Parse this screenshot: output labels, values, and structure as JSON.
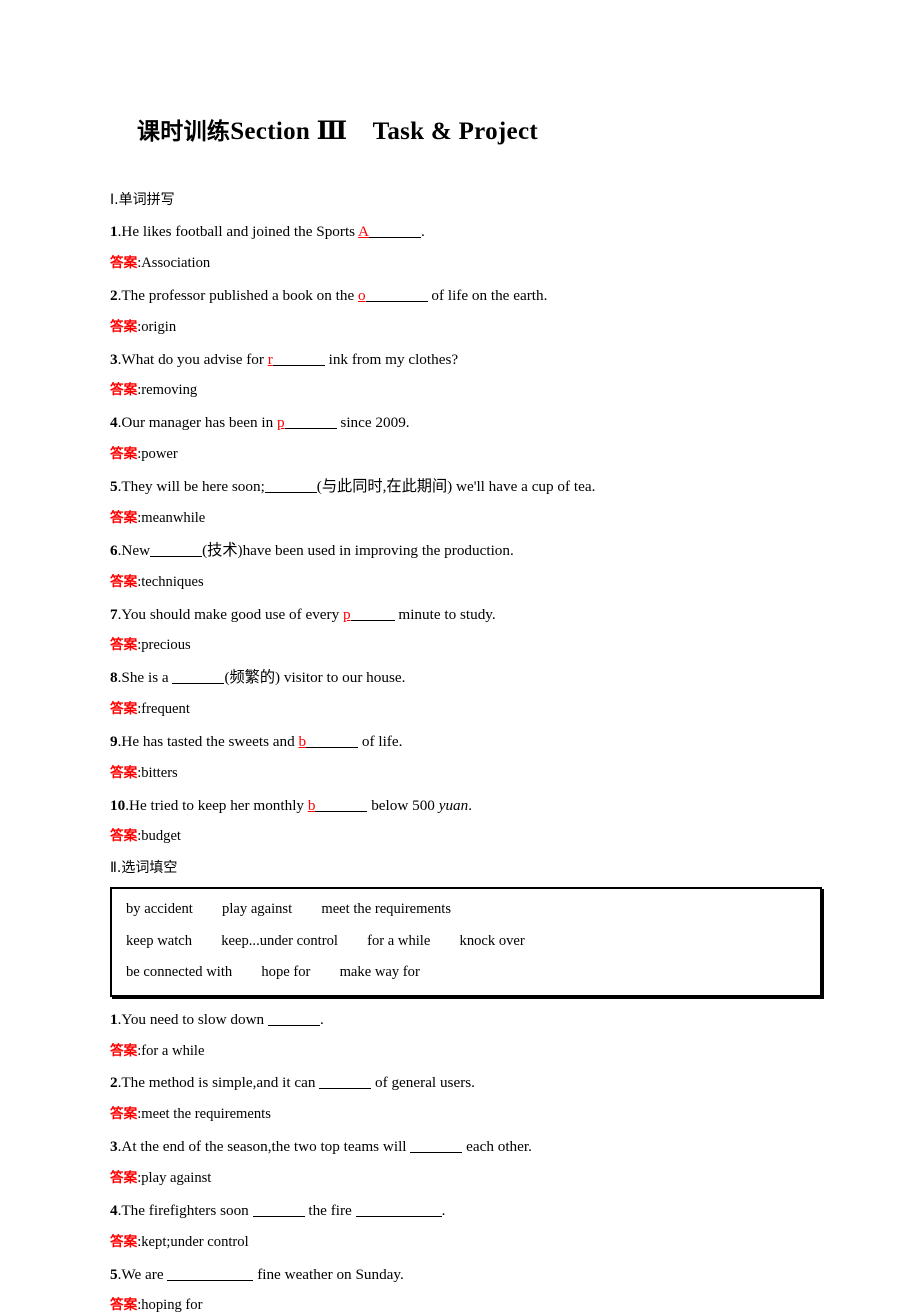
{
  "title": {
    "cn": "课时训练",
    "en": "Section Ⅲ　Task & Project"
  },
  "answer_label": "答案",
  "answer_separator": ":",
  "accent_red": "#ff0000",
  "sections": [
    {
      "heading": "Ⅰ.单词拼写",
      "items": [
        {
          "num": "1",
          "pre": ".He likes football and joined the Sports ",
          "hint": "A",
          "blank": "md",
          "post": ".",
          "answer": "Association"
        },
        {
          "num": "2",
          "pre": ".The professor published a book on the ",
          "hint": "o",
          "blank": "lg",
          "post": " of life on the earth.",
          "answer": "origin"
        },
        {
          "num": "3",
          "pre": ".What do you advise for ",
          "hint": "r",
          "blank": "md",
          "post": " ink from my clothes?",
          "answer": "removing"
        },
        {
          "num": "4",
          "pre": ".Our manager has been in ",
          "hint": "p",
          "blank": "md",
          "post": " since 2009.",
          "answer": "power"
        },
        {
          "num": "5",
          "pre": ".They will be here soon;",
          "hint": "",
          "blank": "md",
          "post": "(与此同时,在此期间) we'll have a cup of tea.",
          "answer": "meanwhile"
        },
        {
          "num": "6",
          "pre": ".New",
          "hint": "",
          "blank": "md",
          "post": "(技术)have been used in improving the production.",
          "answer": "techniques"
        },
        {
          "num": "7",
          "pre": ".You should make good use of every ",
          "hint": "p",
          "blank": "sm",
          "post": " minute to study.",
          "answer": "precious"
        },
        {
          "num": "8",
          "pre": ".She is a ",
          "hint": "",
          "blank": "md",
          "post": "(频繁的) visitor to our house.",
          "answer": "frequent"
        },
        {
          "num": "9",
          "pre": ".He has tasted the sweets and ",
          "hint": "b",
          "blank": "md",
          "post": " of life.",
          "answer": "bitters"
        },
        {
          "num": "10",
          "pre": ".He tried to keep her monthly ",
          "hint": "b",
          "blank": "md",
          "post": " below 500 ",
          "post_italic": "yuan",
          "post2": ".",
          "answer": "budget"
        }
      ]
    },
    {
      "heading": "Ⅱ.选词填空",
      "wordbank": [
        "by accident　　play against　　meet the requirements",
        "keep watch　　keep...under control　　for a while　　knock over",
        "be connected with　　hope for　　make way for"
      ],
      "items": [
        {
          "num": "1",
          "pre": ".You need to slow down ",
          "blank": "md",
          "post": ".",
          "answer": "for a while"
        },
        {
          "num": "2",
          "pre": ".The method is simple,and it can ",
          "blank": "md",
          "post": " of general users.",
          "answer": "meet the requirements"
        },
        {
          "num": "3",
          "pre": ".At the end of the season,the two top teams will ",
          "blank": "md",
          "post": " each other.",
          "answer": "play against"
        },
        {
          "num": "4",
          "pre": ".The firefighters soon ",
          "blank": "md",
          "post": " the fire ",
          "blank2": "xl",
          "post2": ".",
          "answer": "kept;under control"
        },
        {
          "num": "5",
          "pre": ".We are ",
          "blank": "xl",
          "post": " fine weather on Sunday.",
          "answer": "hoping for"
        }
      ]
    }
  ]
}
